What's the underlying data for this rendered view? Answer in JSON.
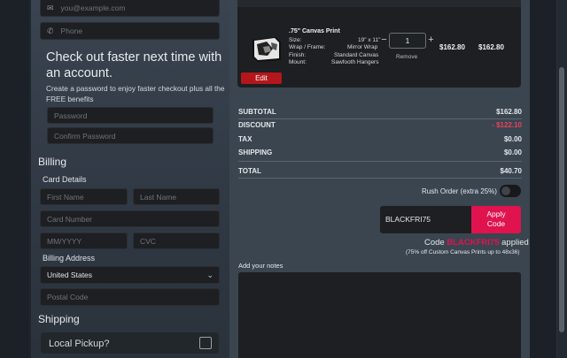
{
  "contact": {
    "email_placeholder": "you@example.com",
    "phone_placeholder": "Phone"
  },
  "account": {
    "heading_line1": "Check out faster next time with",
    "heading_line2": "an account.",
    "desc_line1": "Create a password to enjoy faster checkout plus all the",
    "desc_line2": "FREE benefits",
    "password_placeholder": "Password",
    "confirm_placeholder": "Confirm Password"
  },
  "billing": {
    "heading": "Billing",
    "card_details_label": "Card Details",
    "first_name_placeholder": "First Name",
    "last_name_placeholder": "Last Name",
    "card_number_placeholder": "Card Number",
    "expiry_placeholder": "MM/YYYY",
    "cvc_placeholder": "CVC",
    "address_label": "Billing Address",
    "country_value": "United States",
    "postal_placeholder": "Postal Code"
  },
  "shipping": {
    "heading": "Shipping",
    "local_pickup_label": "Local Pickup?"
  },
  "cart_item": {
    "title": ".75\" Canvas Print",
    "specs": [
      {
        "label": "Size:",
        "value": "19\" x 11\""
      },
      {
        "label": "Wrap / Frame:",
        "value": "Mirror Wrap"
      },
      {
        "label": "Finish:",
        "value": "Standard Canvas"
      },
      {
        "label": "Mount:",
        "value": "Sawfooth Hangers"
      }
    ],
    "quantity": "1",
    "minus": "−",
    "plus": "+",
    "remove_label": "Remove",
    "unit_price": "$162.80",
    "line_total": "$162.80",
    "edit_label": "Edit"
  },
  "summary": {
    "subtotal_label": "SUBTOTAL",
    "subtotal_value": "$162.80",
    "discount_label": "DISCOUNT",
    "discount_value": "- $122.10",
    "tax_label": "TAX",
    "tax_value": "$0.00",
    "shipping_label": "SHIPPING",
    "shipping_value": "$0.00",
    "total_label": "TOTAL",
    "total_value": "$40.70"
  },
  "rush": {
    "label": "Rush Order (extra 25%)",
    "enabled": false
  },
  "promo": {
    "code_value": "BLACKFRI75",
    "apply_line1": "Apply",
    "apply_line2": "Code",
    "status_prefix": "Code",
    "status_code": "BLACKFRI75",
    "status_suffix": "applied",
    "detail": "(75% off Custom Canvas Prints up to 48x36)"
  },
  "notes": {
    "label": "Add your notes"
  },
  "colors": {
    "accent_red": "#e0134f",
    "edit_red": "#b3171b",
    "discount_red": "#f0405a"
  }
}
